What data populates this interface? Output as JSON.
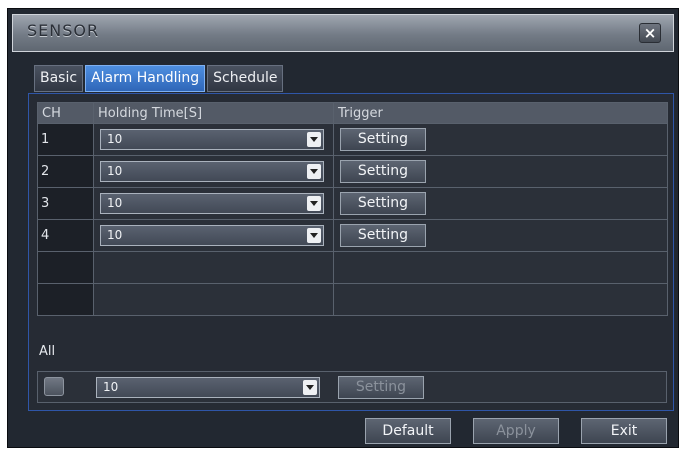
{
  "window": {
    "title": "SENSOR",
    "close_label": "×"
  },
  "tabs": [
    {
      "label": "Basic",
      "active": false
    },
    {
      "label": "Alarm Handling",
      "active": true
    },
    {
      "label": "Schedule",
      "active": false
    }
  ],
  "table": {
    "columns": [
      "CH",
      "Holding Time[S]",
      "Trigger"
    ],
    "rows": [
      {
        "ch": "1",
        "holding_time": "10",
        "trigger_label": "Setting"
      },
      {
        "ch": "2",
        "holding_time": "10",
        "trigger_label": "Setting"
      },
      {
        "ch": "3",
        "holding_time": "10",
        "trigger_label": "Setting"
      },
      {
        "ch": "4",
        "holding_time": "10",
        "trigger_label": "Setting"
      }
    ]
  },
  "all": {
    "label": "All",
    "holding_time": "10",
    "trigger_label": "Setting"
  },
  "footer": {
    "default_label": "Default",
    "apply_label": "Apply",
    "exit_label": "Exit"
  },
  "colors": {
    "window_bg": "#222831",
    "active_tab": "#2f66b8",
    "panel_border": "#2f56a8"
  }
}
